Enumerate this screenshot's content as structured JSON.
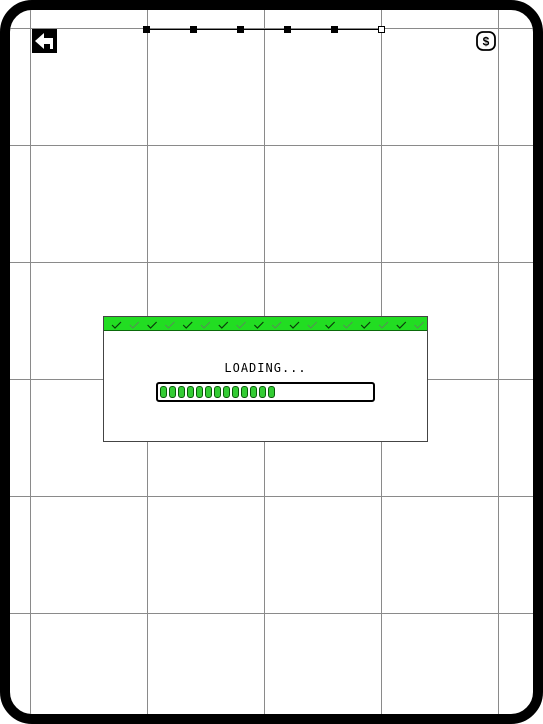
{
  "game": {
    "loading_text": "LOADING...",
    "progress": {
      "filled_segments": 13,
      "total_segments": 23
    },
    "level_path": {
      "nodes": [
        {
          "state": "complete"
        },
        {
          "state": "complete"
        },
        {
          "state": "complete"
        },
        {
          "state": "complete"
        },
        {
          "state": "complete"
        },
        {
          "state": "open"
        }
      ]
    },
    "icons": {
      "back": "back-arrow-icon",
      "coin": "dollar-coin-icon",
      "header_pattern": "checkmark-icon"
    },
    "colors": {
      "header_green": "#22dd22",
      "progress_green": "#33cc33",
      "frame": "#000000",
      "grid": "#8a8a8a"
    }
  }
}
